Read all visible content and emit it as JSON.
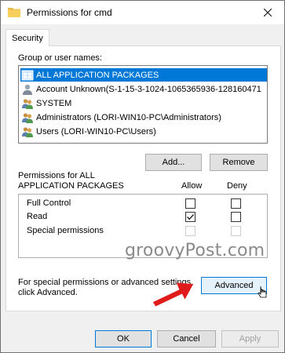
{
  "window": {
    "title": "Permissions for cmd",
    "title_icon": "folder-icon",
    "close_icon": "close-icon"
  },
  "tabs": [
    {
      "label": "Security"
    }
  ],
  "group_label": "Group or user names:",
  "users": [
    {
      "name": "ALL APPLICATION PACKAGES",
      "icon": "package-group-icon",
      "selected": true
    },
    {
      "name": "Account Unknown(S-1-15-3-1024-1065365936-128160471",
      "icon": "unknown-user-icon",
      "selected": false
    },
    {
      "name": "SYSTEM",
      "icon": "users-icon",
      "selected": false
    },
    {
      "name": "Administrators (LORI-WIN10-PC\\Administrators)",
      "icon": "users-icon",
      "selected": false
    },
    {
      "name": "Users (LORI-WIN10-PC\\Users)",
      "icon": "users-icon",
      "selected": false
    }
  ],
  "buttons": {
    "add": "Add...",
    "remove": "Remove",
    "advanced": "Advanced",
    "ok": "OK",
    "cancel": "Cancel",
    "apply": "Apply"
  },
  "perm_header": {
    "line1": "Permissions for ALL",
    "line2": "APPLICATION PACKAGES",
    "allow": "Allow",
    "deny": "Deny"
  },
  "permissions": [
    {
      "name": "Full Control",
      "allow": false,
      "deny": false,
      "enabled": true
    },
    {
      "name": "Read",
      "allow": true,
      "deny": false,
      "enabled": true
    },
    {
      "name": "Special permissions",
      "allow": false,
      "deny": false,
      "enabled": false
    }
  ],
  "special_text": {
    "line1": "For special permissions or advanced se",
    "line1_tail": "ttings,",
    "line2": "click Advanced."
  },
  "watermark": "groovyPost.com",
  "colors": {
    "selection": "#0078d7",
    "arrow": "#e01b1b",
    "focus_border": "#0078d7"
  }
}
